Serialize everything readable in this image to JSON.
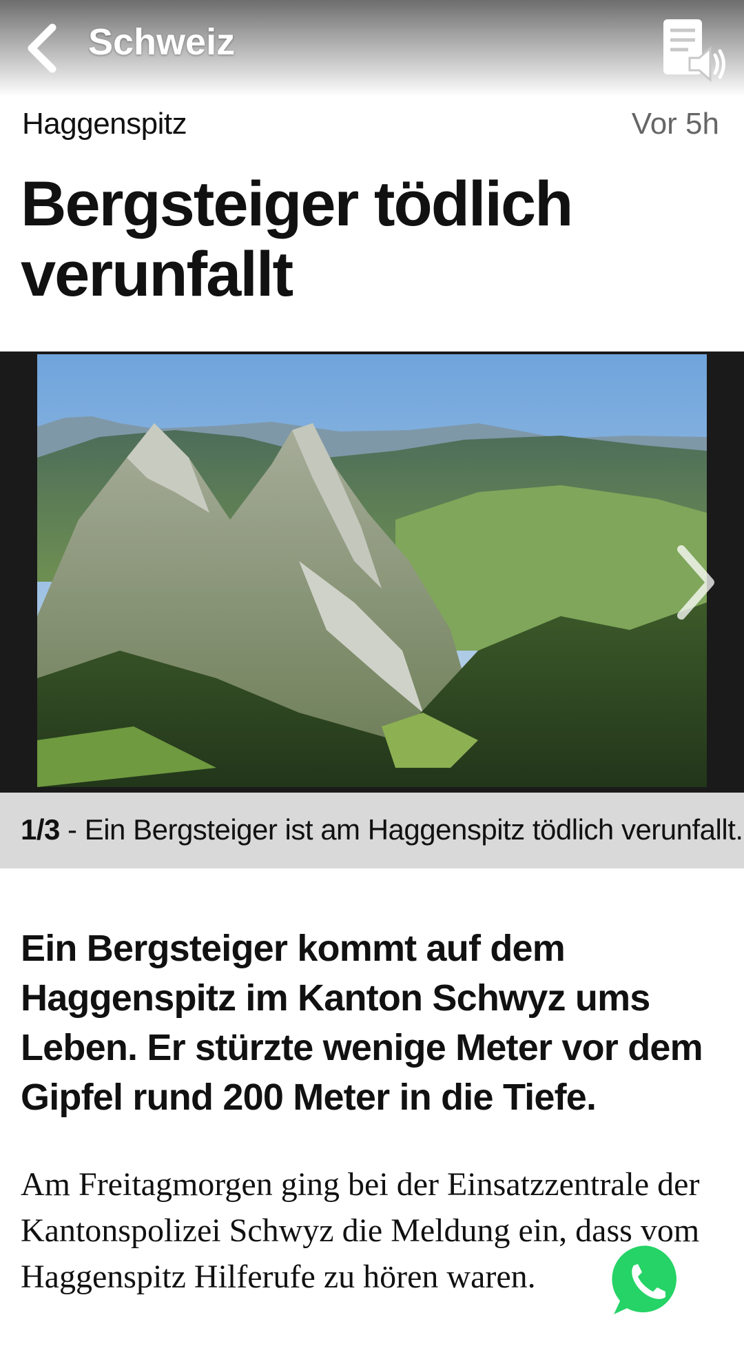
{
  "header": {
    "back_icon": "chevron-left-icon",
    "section_title": "Schweiz",
    "audio_icon": "read-aloud-icon"
  },
  "article": {
    "kicker": "Haggenspitz",
    "timestamp": "Vor 5h",
    "headline": "Bergsteiger tödlich verunfallt",
    "gallery": {
      "counter": "1/3",
      "caption": " - Ein Bergsteiger ist am Haggenspitz tödlich verunfallt.",
      "next_icon": "chevron-right-icon"
    },
    "lead": "Ein Bergsteiger kommt auf dem Haggenspitz im Kanton Schwyz ums Leben. Er stürzte wenige Meter vor dem Gipfel rund 200 Meter in die Tiefe.",
    "body": "Am Freitagmorgen ging bei der Einsatzzentrale der Kantonspolizei Schwyz die Meldung ein, dass vom Haggenspitz Hilferufe zu hören waren."
  },
  "share": {
    "icon": "whatsapp-icon",
    "color": "#25D366"
  }
}
